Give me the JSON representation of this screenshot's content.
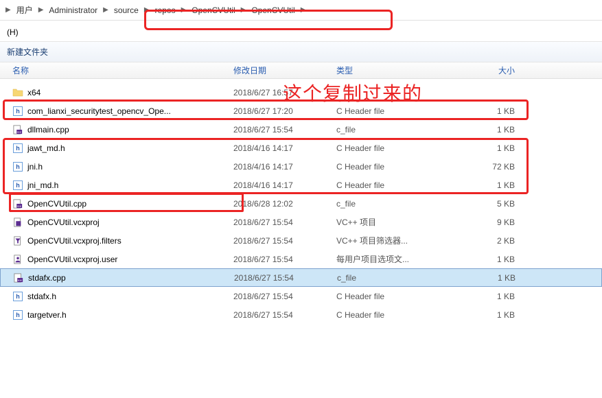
{
  "breadcrumb": {
    "items": [
      "用户",
      "Administrator",
      "source",
      "repos",
      "OpenCVUtil",
      "OpenCVUtil"
    ]
  },
  "menubar": {
    "help": "(H)"
  },
  "toolbar": {
    "new_folder": "新建文件夹"
  },
  "columns": {
    "name": "名称",
    "date": "修改日期",
    "type": "类型",
    "size": "大小"
  },
  "annotation": "这个复制过来的",
  "files": [
    {
      "icon": "folder",
      "name": "x64",
      "date": "2018/6/27 16:57",
      "type": "",
      "size": ""
    },
    {
      "icon": "h",
      "name": "com_lianxi_securitytest_opencv_Ope...",
      "date": "2018/6/27 17:20",
      "type": "C Header file",
      "size": "1 KB"
    },
    {
      "icon": "cpp",
      "name": "dllmain.cpp",
      "date": "2018/6/27 15:54",
      "type": "c_file",
      "size": "1 KB"
    },
    {
      "icon": "h",
      "name": "jawt_md.h",
      "date": "2018/4/16 14:17",
      "type": "C Header file",
      "size": "1 KB"
    },
    {
      "icon": "h",
      "name": "jni.h",
      "date": "2018/4/16 14:17",
      "type": "C Header file",
      "size": "72 KB"
    },
    {
      "icon": "h",
      "name": "jni_md.h",
      "date": "2018/4/16 14:17",
      "type": "C Header file",
      "size": "1 KB"
    },
    {
      "icon": "cpp",
      "name": "OpenCVUtil.cpp",
      "date": "2018/6/28 12:02",
      "type": "c_file",
      "size": "5 KB"
    },
    {
      "icon": "proj",
      "name": "OpenCVUtil.vcxproj",
      "date": "2018/6/27 15:54",
      "type": "VC++ 项目",
      "size": "9 KB"
    },
    {
      "icon": "filter",
      "name": "OpenCVUtil.vcxproj.filters",
      "date": "2018/6/27 15:54",
      "type": "VC++ 项目筛选器...",
      "size": "2 KB"
    },
    {
      "icon": "user",
      "name": "OpenCVUtil.vcxproj.user",
      "date": "2018/6/27 15:54",
      "type": "每用户项目选项文...",
      "size": "1 KB"
    },
    {
      "icon": "cpp",
      "name": "stdafx.cpp",
      "date": "2018/6/27 15:54",
      "type": "c_file",
      "size": "1 KB",
      "selected": true
    },
    {
      "icon": "h",
      "name": "stdafx.h",
      "date": "2018/6/27 15:54",
      "type": "C Header file",
      "size": "1 KB"
    },
    {
      "icon": "h",
      "name": "targetver.h",
      "date": "2018/6/27 15:54",
      "type": "C Header file",
      "size": "1 KB"
    }
  ]
}
